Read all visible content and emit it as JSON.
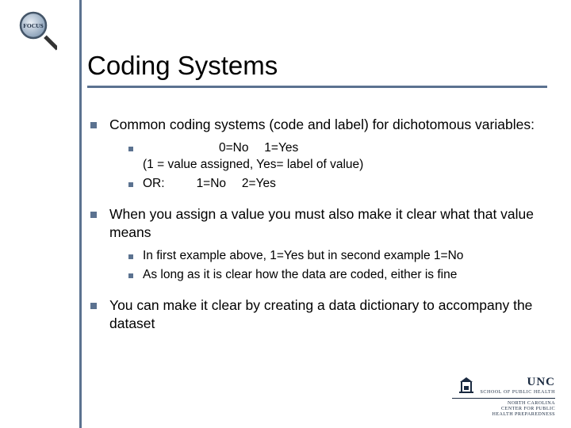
{
  "title": "Coding Systems",
  "bullets": {
    "b1": "Common coding systems (code and label) for dichotomous variables:",
    "b1_sub1_line1": "0=No  1=Yes",
    "b1_sub1_line2": "(1 = value assigned, Yes= label of value)",
    "b1_sub2_prefix": "OR:",
    "b1_sub2_rest": "1=No  2=Yes",
    "b2": "When you assign a value you must also make it clear what that value means",
    "b2_sub1": "In first example above, 1=Yes but in second example 1=No",
    "b2_sub2": "As long as it is clear how the data are coded, either is fine",
    "b3": "You can make it clear by creating a data dictionary to accompany the dataset"
  },
  "logo_text": {
    "unc": "UNC",
    "school": "SCHOOL OF PUBLIC HEALTH",
    "center1": "NORTH CAROLINA",
    "center2": "CENTER FOR PUBLIC",
    "center3": "HEALTH PREPAREDNESS"
  }
}
